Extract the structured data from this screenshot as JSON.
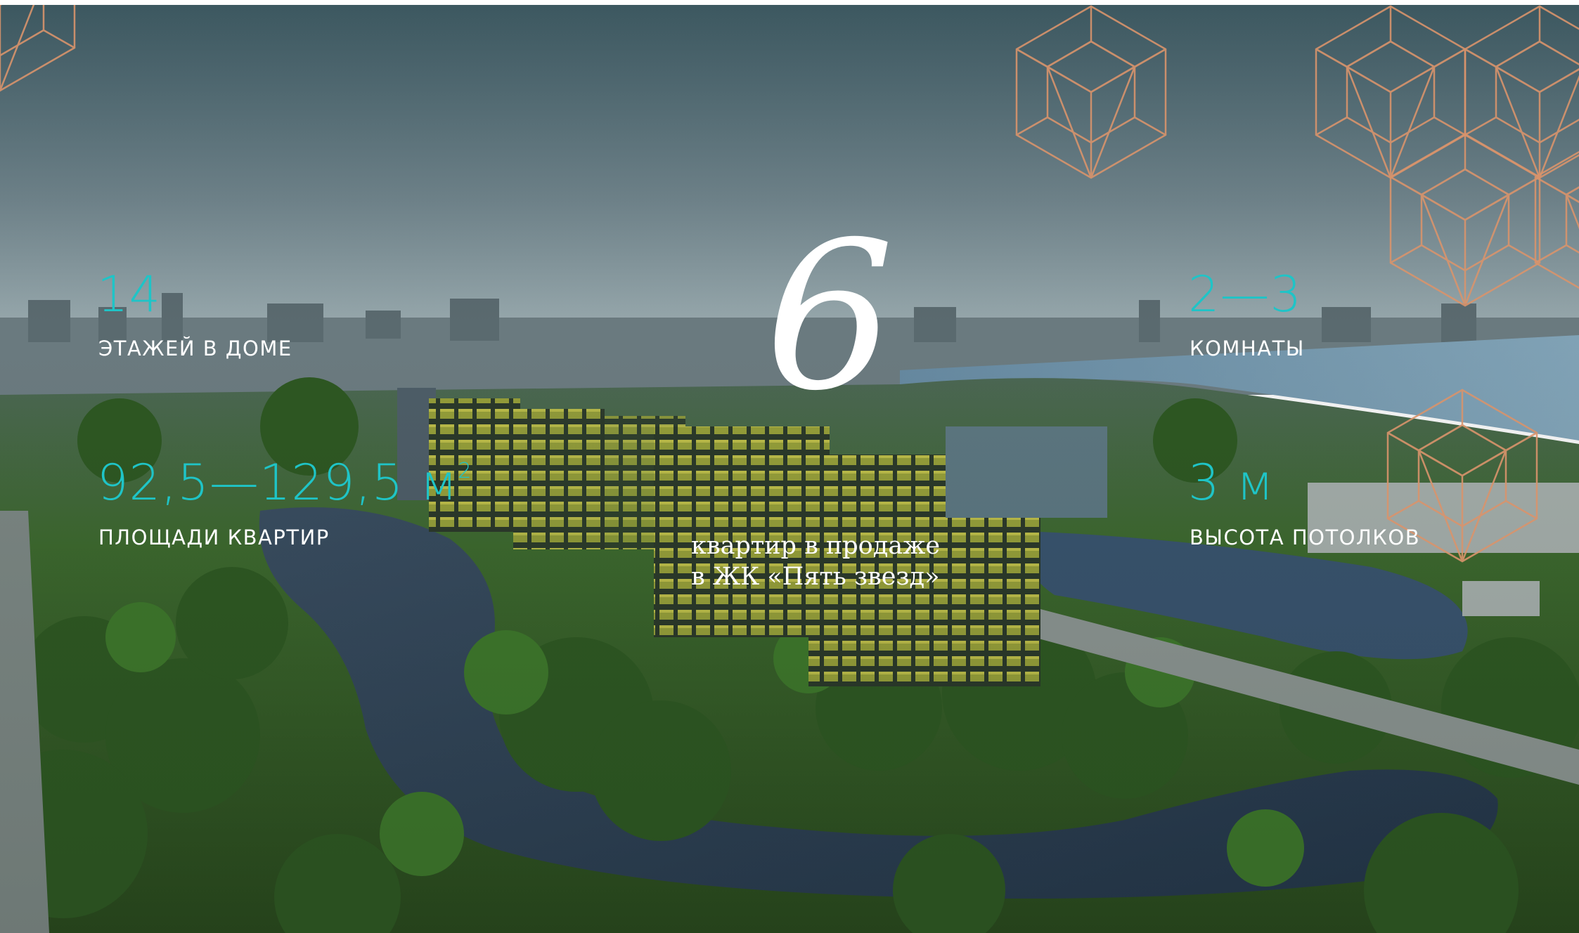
{
  "stats": {
    "floors": {
      "value": "14",
      "label": "ЭТАЖЕЙ В ДОМЕ"
    },
    "area": {
      "value": "92,5—129,5 м",
      "value_sup": "2",
      "label": "ПЛОЩАДИ КВАРТИР"
    },
    "rooms": {
      "value": "2—3",
      "label": "КОМНАТЫ"
    },
    "ceiling": {
      "value": "3 м",
      "label": "ВЫСОТА ПОТОЛКОВ"
    }
  },
  "center": {
    "number": "6",
    "caption_line1": "квартир в продаже",
    "caption_line2": "в ЖК «Пять звезд»"
  },
  "colors": {
    "accent": "#1fc4c7",
    "ornament": "#d9946c",
    "text": "#ffffff"
  },
  "icons": {
    "ornament": "hexagon-cube-pattern"
  }
}
